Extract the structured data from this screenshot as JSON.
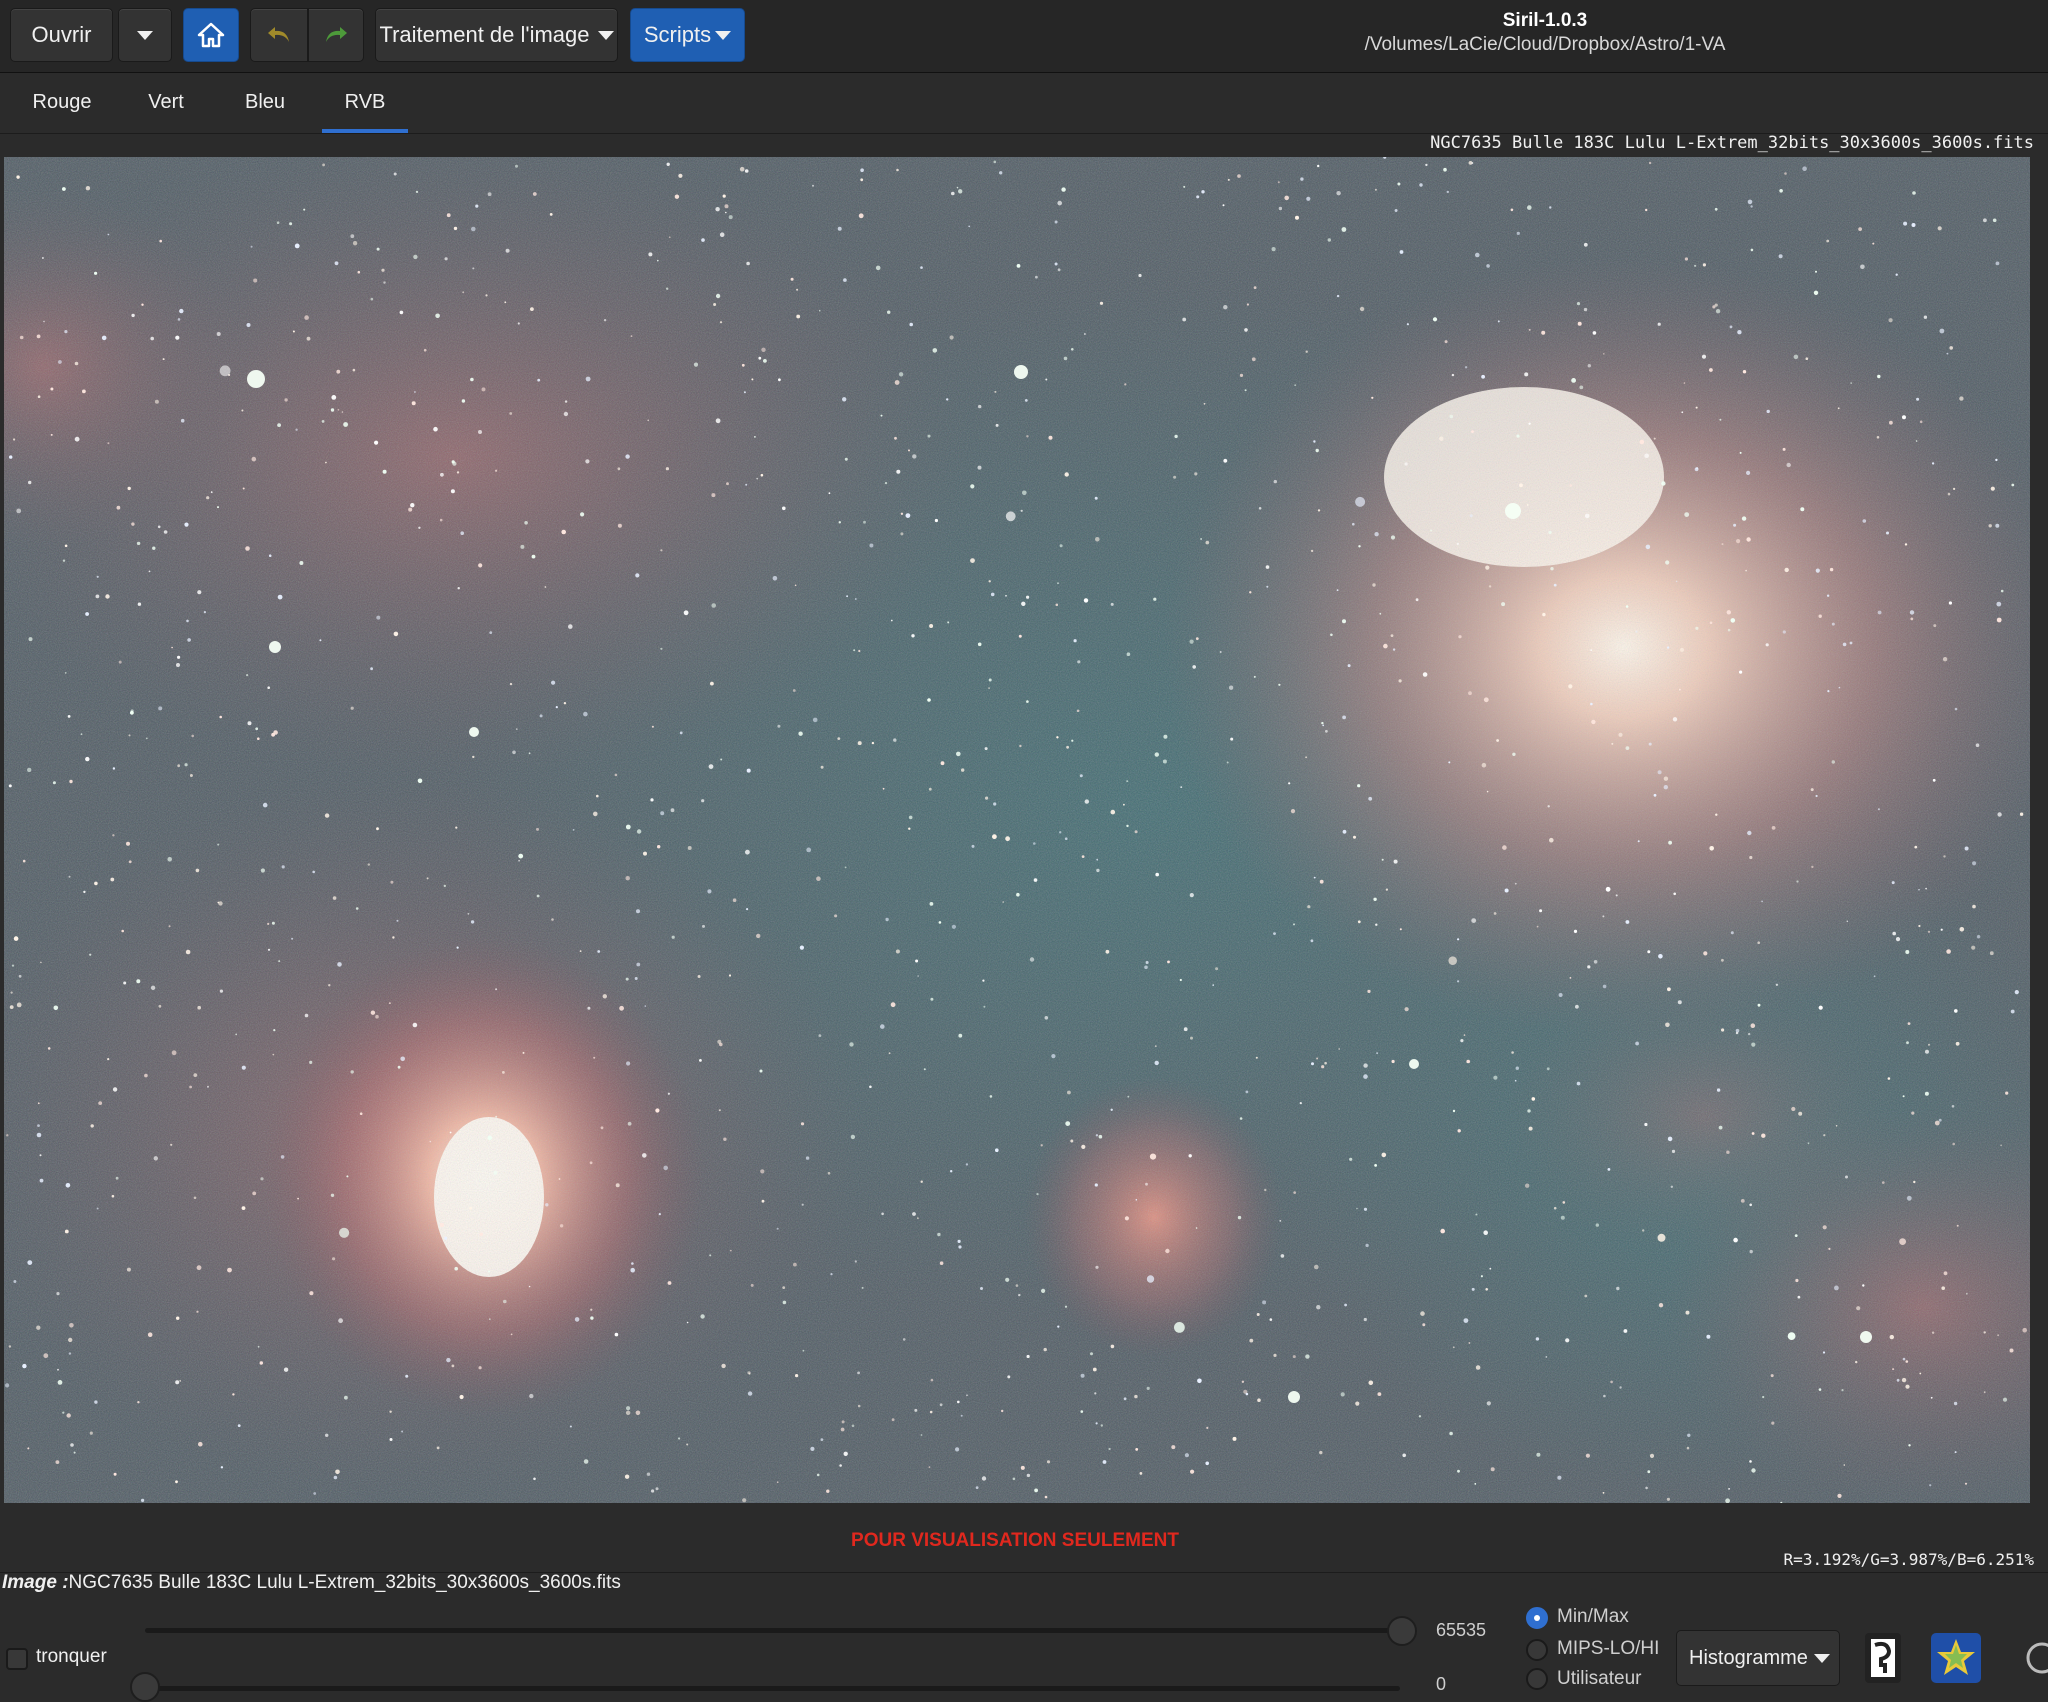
{
  "toolbar": {
    "open_label": "Ouvrir",
    "processing_label": "Traitement de l'image",
    "scripts_label": "Scripts"
  },
  "window": {
    "title": "Siril-1.0.3",
    "path": "/Volumes/LaCie/Cloud/Dropbox/Astro/1-VA"
  },
  "tabs": [
    {
      "label": "Rouge"
    },
    {
      "label": "Vert"
    },
    {
      "label": "Bleu"
    },
    {
      "label": "RVB",
      "active": true
    }
  ],
  "image": {
    "filename": "NGC7635 Bulle 183C Lulu L-Extrem_32bits_30x3600s_3600s.fits",
    "watermark": "POUR VISUALISATION SEULEMENT",
    "rgb_stats": "R=3.192%/G=3.987%/B=6.251%"
  },
  "bottom": {
    "image_prefix": "Image :",
    "image_name": "NGC7635 Bulle 183C Lulu L-Extrem_32bits_30x3600s_3600s.fits",
    "clip_label": "tronquer",
    "high_value": "65535",
    "low_value": "0",
    "modes": [
      "Min/Max",
      "MIPS-LO/HI",
      "Utilisateur"
    ],
    "selected_mode": "Min/Max",
    "display_mode": "Histogramme"
  },
  "colors": {
    "accent": "#2f6fd0",
    "watermark": "#e0281e",
    "background": "#2b2b2b"
  }
}
